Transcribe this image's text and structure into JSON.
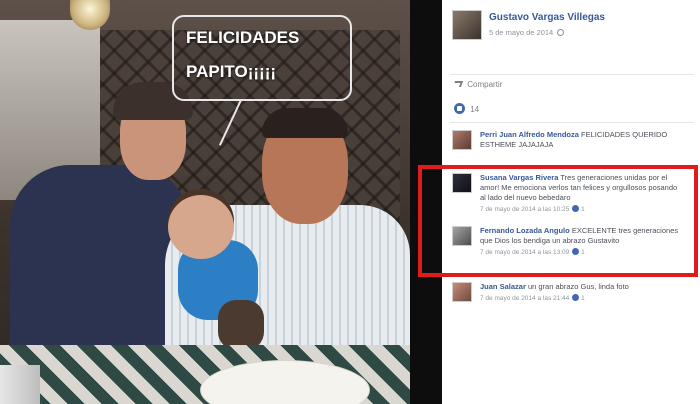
{
  "photo": {
    "caption_line1": "FELICIDADES",
    "caption_line2": "PAPITO¡¡¡¡¡"
  },
  "post": {
    "author": "Gustavo Vargas Villegas",
    "date": "5 de mayo de 2014",
    "share_label": "Compartir",
    "like_count": "14"
  },
  "comments": [
    {
      "name": "Perri Juan Alfredo Mendoza",
      "text": "FELICIDADES QUERIDO ESTHEME JAJAJAJA",
      "meta": ""
    },
    {
      "name": "Susana Vargas Rivera",
      "text": "Tres generaciones unidas por el amor! Me emociona verlos tan felices y orgullosos posando al lado del nuevo bebedaro",
      "meta": "7 de mayo de 2014 a las 10:25",
      "likes": "1"
    },
    {
      "name": "Fernando Lozada Angulo",
      "text": "EXCELENTE tres generaciones que Dios los bendiga un abrazo Gustavito",
      "meta": "7 de mayo de 2014 a las 13:09",
      "likes": "1"
    },
    {
      "name": "Juan Salazar",
      "text": "un gran abrazo Gus, linda foto",
      "meta": "7 de mayo de 2014 a las 21:44",
      "likes": "1"
    }
  ],
  "colors": {
    "highlight": "#e01b1b",
    "link_blue": "#365899"
  }
}
